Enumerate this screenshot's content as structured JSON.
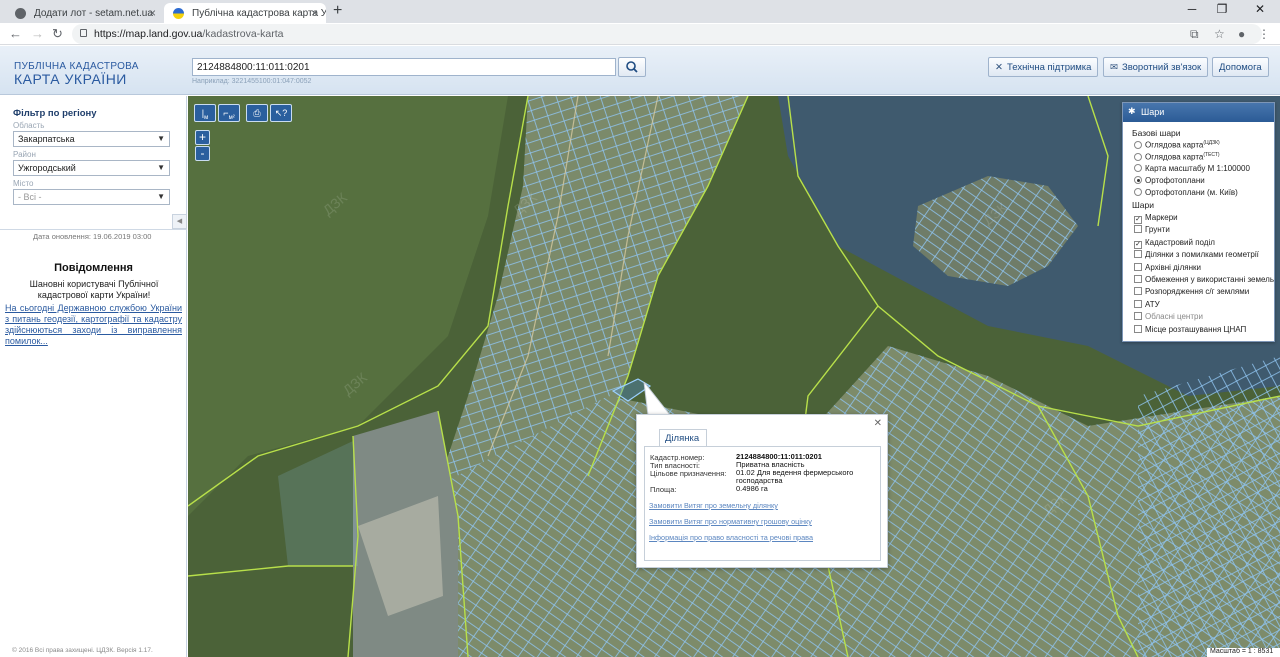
{
  "browser": {
    "tabs": [
      {
        "title": "Додати лот - setam.net.ua",
        "active": false
      },
      {
        "title": "Публічна кадастрова карта Укр",
        "active": true
      }
    ],
    "url_host": "https://map.land.gov.ua",
    "url_path": "/kadastrova-karta"
  },
  "header": {
    "logo_line1": "ПУБЛІЧНА КАДАСТРОВА",
    "logo_line2": "КАРТА УКРАЇНИ",
    "search_value": "2124884800:11:011:0201",
    "search_hint": "Наприклад: 3221455100:01:047:0052",
    "buttons": {
      "support": "Технічна підтримка",
      "feedback": "Зворотний зв'язок",
      "help": "Допомога"
    }
  },
  "filter": {
    "title": "Фільтр по регіону",
    "oblast_label": "Область",
    "oblast_value": "Закарпатська",
    "raion_label": "Район",
    "raion_value": "Ужгородський",
    "misto_label": "Місто",
    "misto_value": "- Всі -",
    "updated": "Дата оновлення: 19.06.2019 03:00"
  },
  "notice": {
    "title": "Повідомлення",
    "body": "Шановні користувачі Публічної кадастрової карти України!",
    "link": "На сьогодні Державною службою України з питань геодезії, картографії та кадастру здійснюються заходи із виправлення помилок..."
  },
  "footer": {
    "copyright": "© 2016 Всі права захищені. ЦДЗК. Версія 1.17."
  },
  "map": {
    "zoom_in": "+",
    "zoom_out": "-",
    "scale": "Масштаб = 1 : 8531",
    "tools": [
      "м",
      "м²"
    ]
  },
  "layers": {
    "title": "Шари",
    "base_heading": "Базові шари",
    "base": [
      {
        "label": "Оглядова карта",
        "sup": "(ЦДЗК)",
        "selected": false
      },
      {
        "label": "Оглядова карта",
        "sup": "(ТЕСТ)",
        "selected": false
      },
      {
        "label": "Карта масштабу М 1:100000",
        "sup": "",
        "selected": false
      },
      {
        "label": "Ортофотоплани",
        "sup": "",
        "selected": true
      },
      {
        "label": "Ортофотоплани (м. Київ)",
        "sup": "",
        "selected": false
      }
    ],
    "overlay_heading": "Шари",
    "overlays": [
      {
        "label": "Маркери",
        "checked": true,
        "enabled": true
      },
      {
        "label": "Грунти",
        "checked": false,
        "enabled": true
      },
      {
        "label": "Кадастровий поділ",
        "checked": true,
        "enabled": true
      },
      {
        "label": "Ділянки з помилками геометрії",
        "checked": false,
        "enabled": true
      },
      {
        "label": "Архівні ділянки",
        "checked": false,
        "enabled": true
      },
      {
        "label": "Обмеження у використанні земель",
        "checked": false,
        "enabled": true
      },
      {
        "label": "Розпорядження с/г землями",
        "checked": false,
        "enabled": true
      },
      {
        "label": "АТУ",
        "checked": false,
        "enabled": true
      },
      {
        "label": "Обласні центри",
        "checked": false,
        "enabled": false
      },
      {
        "label": "Місце розташування ЦНАП",
        "checked": false,
        "enabled": true
      }
    ]
  },
  "popup": {
    "tab": "Ділянка",
    "fields": [
      {
        "k": "Кадастр.номер:",
        "v": "2124884800:11:011:0201"
      },
      {
        "k": "Тип власності:",
        "v": "Приватна власність"
      },
      {
        "k": "Цільове призначення:",
        "v": "01.02 Для ведення фермерського господарства"
      },
      {
        "k": "Площа:",
        "v": "0.4986 га"
      }
    ],
    "links": [
      "Замовити Витяг про земельну ділянку",
      "Замовити Витяг про нормативну грошову оцінку",
      "Інформація про право власності та речові права"
    ]
  },
  "colors": {
    "brand": "#2a5aa0",
    "parcel": "#8fc3ef",
    "boundary": "#b8e04a",
    "forest": "#46603a",
    "water": "#4a6b8e"
  }
}
